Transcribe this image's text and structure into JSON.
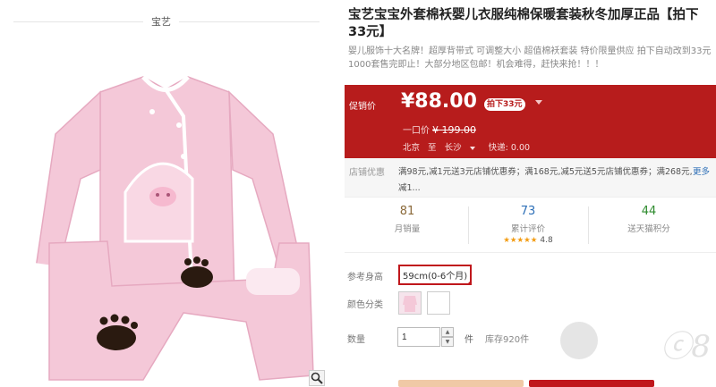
{
  "left": {
    "brand": "宝艺"
  },
  "product": {
    "title": "宝艺宝宝外套棉袄婴儿衣服纯棉保暖套装秋冬加厚正品【拍下33元】",
    "subtitle": "婴儿服饰十大名牌！超厚背带式 可调整大小 超值棉袄套装 特价限量供应 拍下自动改到33元 1000套售完即止！大部分地区包邮！机会难得，赶快来抢！！！"
  },
  "promo": {
    "label": "促销价",
    "price": "¥88.00",
    "badge": "拍下33元",
    "orig_label": "一口价",
    "orig_price": "¥ 199.00",
    "ship_from": "北京",
    "ship_to_label": "至",
    "ship_to": "长沙",
    "ship_fee": "快递: 0.00"
  },
  "coupon": {
    "label": "店铺优惠",
    "text": "满98元,减1元送3元店铺优惠券；满168元,减5元送5元店铺优惠券；满268元,减1...",
    "more": "更多"
  },
  "stats": [
    {
      "num": "81",
      "label": "月销量",
      "color": "#8b6a3a"
    },
    {
      "num": "73",
      "label": "累计评价",
      "color": "#2d6fb7"
    },
    {
      "num": "44",
      "label": "送天猫积分",
      "color": "#2e8b2e"
    }
  ],
  "rating": {
    "stars": "★★★★★",
    "score": "4.8"
  },
  "options": {
    "size_label": "参考身高",
    "size_value": "59cm(0-6个月)",
    "color_label": "颜色分类",
    "qty_label": "数量",
    "qty_value": "1",
    "qty_unit": "件",
    "stock": "库存920件"
  },
  "colors": {
    "accent": "#b71c1c",
    "selected_border": "#c0171c"
  },
  "watermark": "ⓒ8"
}
